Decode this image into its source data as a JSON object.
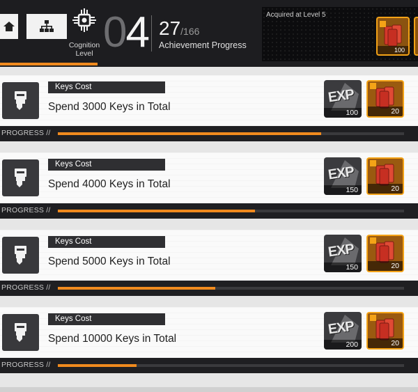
{
  "header": {
    "cognition_label_line1": "Cognition",
    "cognition_label_line2": "Level",
    "level_leading_zero": "0",
    "level_value": "4",
    "achievement_count": "27",
    "achievement_total": "/166",
    "achievement_label": "Achievement Progress",
    "acquired_label": "Acquired at Level 5",
    "acquired_reward_qty": "100"
  },
  "colors": {
    "accent": "#f08a1e",
    "reward_border": "#f4a317",
    "panel_dark": "#1d1d20"
  },
  "achievements": [
    {
      "category": "Keys Cost",
      "description": "Spend 3000 Keys in Total",
      "exp_qty": "100",
      "chip_qty": "20",
      "progress_label": "PROGRESS //",
      "progress": 0.76
    },
    {
      "category": "Keys Cost",
      "description": "Spend 4000 Keys in Total",
      "exp_qty": "150",
      "chip_qty": "20",
      "progress_label": "PROGRESS //",
      "progress": 0.57
    },
    {
      "category": "Keys Cost",
      "description": "Spend 5000 Keys in Total",
      "exp_qty": "150",
      "chip_qty": "20",
      "progress_label": "PROGRESS //",
      "progress": 0.455
    },
    {
      "category": "Keys Cost",
      "description": "Spend 10000 Keys in Total",
      "exp_qty": "200",
      "chip_qty": "20",
      "progress_label": "PROGRESS //",
      "progress": 0.228
    }
  ],
  "reward_exp_text": "EXP",
  "icons": {
    "home": "home-icon",
    "tree": "hierarchy-icon",
    "cognition": "cognition-chip-icon",
    "key": "key-icon",
    "exp": "exp-reward-icon",
    "chip": "red-chip-reward-icon"
  }
}
